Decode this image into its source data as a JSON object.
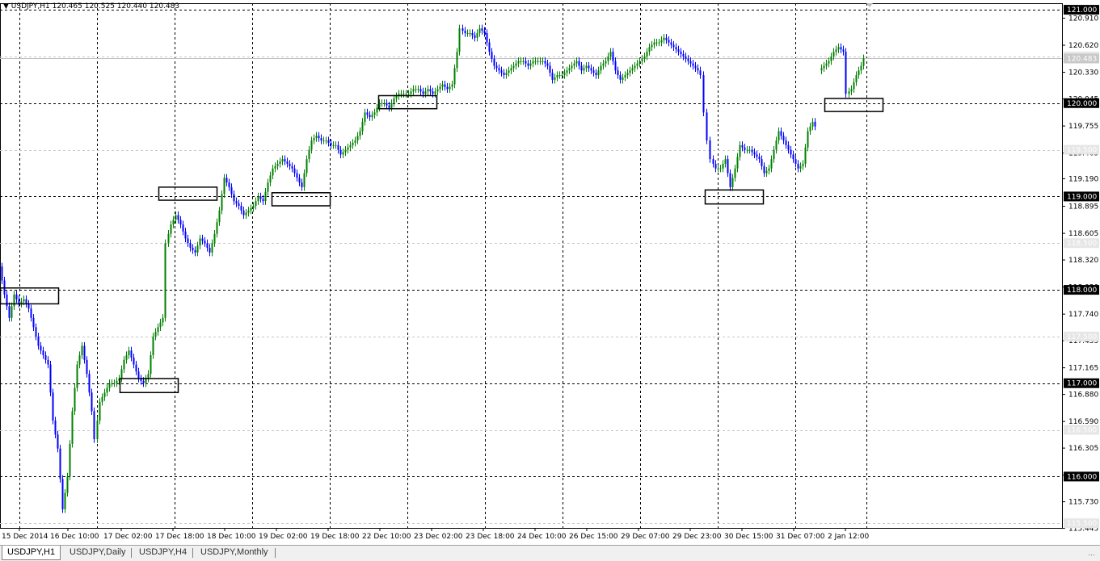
{
  "window": {
    "header_symbol": "USDJPY,H1",
    "header_ohlc": "120.465 120.525 120.440 120.483",
    "collapse_icon": "triangle-down-icon"
  },
  "tabs": [
    {
      "label": "USDJPY,H1",
      "active": true
    },
    {
      "label": "USDJPY,Daily",
      "active": false
    },
    {
      "label": "USDJPY,H4",
      "active": false
    },
    {
      "label": "USDJPY,Monthly",
      "active": false
    }
  ],
  "chart_data": {
    "type": "candlestick",
    "symbol": "USDJPY",
    "timeframe": "H1",
    "ylim": [
      115.45,
      121.07
    ],
    "grid": true,
    "colors": {
      "bull": "#008000",
      "bear": "#0000ff",
      "grid": "#000000",
      "level_line": "#000000",
      "gray_level": "#c8c8c8",
      "box": "#000000"
    },
    "price_ticks": [
      "120.910",
      "120.620",
      "120.330",
      "120.045",
      "119.755",
      "119.465",
      "119.190",
      "118.895",
      "118.605",
      "118.320",
      "118.030",
      "117.740",
      "117.455",
      "117.165",
      "116.880",
      "116.590",
      "116.305",
      "116.015",
      "115.730",
      "115.445"
    ],
    "level_labels": [
      "121.000",
      "120.000",
      "119.000",
      "118.000",
      "117.000",
      "116.000"
    ],
    "gray_level_labels": [
      "120.500",
      "119.500",
      "118.500",
      "117.500",
      "116.500",
      "115.500"
    ],
    "current_price": "120.483",
    "time_labels": [
      "15 Dec 2014",
      "16 Dec 10:00",
      "17 Dec 02:00",
      "17 Dec 18:00",
      "18 Dec 10:00",
      "19 Dec 02:00",
      "19 Dec 18:00",
      "22 Dec 10:00",
      "23 Dec 02:00",
      "23 Dec 18:00",
      "24 Dec 10:00",
      "26 Dec 15:00",
      "29 Dec 07:00",
      "29 Dec 23:00",
      "30 Dec 15:00",
      "31 Dec 07:00",
      "2 Jan 12:00"
    ],
    "price_path": [
      [
        0,
        118.25
      ],
      [
        6,
        117.95
      ],
      [
        12,
        117.7
      ],
      [
        18,
        117.95
      ],
      [
        24,
        117.85
      ],
      [
        30,
        117.9
      ],
      [
        36,
        117.8
      ],
      [
        42,
        117.6
      ],
      [
        48,
        117.4
      ],
      [
        54,
        117.3
      ],
      [
        60,
        117.2
      ],
      [
        66,
        116.6
      ],
      [
        72,
        116.3
      ],
      [
        78,
        115.65
      ],
      [
        84,
        116.0
      ],
      [
        90,
        116.7
      ],
      [
        96,
        117.2
      ],
      [
        102,
        117.4
      ],
      [
        108,
        117.1
      ],
      [
        114,
        116.7
      ],
      [
        118,
        116.4
      ],
      [
        124,
        116.8
      ],
      [
        130,
        116.9
      ],
      [
        136,
        117.0
      ],
      [
        142,
        117.0
      ],
      [
        148,
        117.05
      ],
      [
        154,
        117.25
      ],
      [
        160,
        117.35
      ],
      [
        166,
        117.2
      ],
      [
        172,
        117.05
      ],
      [
        178,
        117.0
      ],
      [
        184,
        117.1
      ],
      [
        190,
        117.5
      ],
      [
        196,
        117.6
      ],
      [
        202,
        117.7
      ],
      [
        206,
        118.5
      ],
      [
        212,
        118.7
      ],
      [
        218,
        118.8
      ],
      [
        224,
        118.7
      ],
      [
        230,
        118.55
      ],
      [
        236,
        118.45
      ],
      [
        242,
        118.4
      ],
      [
        248,
        118.55
      ],
      [
        254,
        118.5
      ],
      [
        260,
        118.4
      ],
      [
        266,
        118.6
      ],
      [
        272,
        118.85
      ],
      [
        278,
        119.2
      ],
      [
        284,
        119.1
      ],
      [
        290,
        118.95
      ],
      [
        296,
        118.9
      ],
      [
        302,
        118.8
      ],
      [
        308,
        118.85
      ],
      [
        314,
        118.9
      ],
      [
        320,
        119.0
      ],
      [
        326,
        118.95
      ],
      [
        332,
        119.15
      ],
      [
        338,
        119.3
      ],
      [
        344,
        119.35
      ],
      [
        350,
        119.4
      ],
      [
        356,
        119.35
      ],
      [
        362,
        119.3
      ],
      [
        368,
        119.2
      ],
      [
        374,
        119.1
      ],
      [
        380,
        119.4
      ],
      [
        386,
        119.6
      ],
      [
        392,
        119.65
      ],
      [
        398,
        119.6
      ],
      [
        404,
        119.6
      ],
      [
        410,
        119.55
      ],
      [
        416,
        119.55
      ],
      [
        422,
        119.45
      ],
      [
        428,
        119.5
      ],
      [
        434,
        119.55
      ],
      [
        440,
        119.6
      ],
      [
        446,
        119.7
      ],
      [
        452,
        119.9
      ],
      [
        458,
        119.85
      ],
      [
        464,
        119.9
      ],
      [
        470,
        120.0
      ],
      [
        476,
        120.0
      ],
      [
        482,
        119.95
      ],
      [
        488,
        120.05
      ],
      [
        494,
        120.1
      ],
      [
        500,
        120.1
      ],
      [
        506,
        120.1
      ],
      [
        512,
        120.15
      ],
      [
        518,
        120.15
      ],
      [
        524,
        120.1
      ],
      [
        530,
        120.15
      ],
      [
        536,
        120.1
      ],
      [
        542,
        120.15
      ],
      [
        548,
        120.2
      ],
      [
        554,
        120.15
      ],
      [
        560,
        120.2
      ],
      [
        566,
        120.55
      ],
      [
        570,
        120.8
      ],
      [
        576,
        120.75
      ],
      [
        582,
        120.75
      ],
      [
        588,
        120.7
      ],
      [
        594,
        120.8
      ],
      [
        600,
        120.75
      ],
      [
        606,
        120.55
      ],
      [
        612,
        120.4
      ],
      [
        618,
        120.35
      ],
      [
        624,
        120.3
      ],
      [
        630,
        120.35
      ],
      [
        636,
        120.4
      ],
      [
        642,
        120.45
      ],
      [
        648,
        120.45
      ],
      [
        654,
        120.4
      ],
      [
        660,
        120.45
      ],
      [
        666,
        120.45
      ],
      [
        672,
        120.45
      ],
      [
        678,
        120.4
      ],
      [
        684,
        120.25
      ],
      [
        690,
        120.3
      ],
      [
        696,
        120.3
      ],
      [
        702,
        120.35
      ],
      [
        708,
        120.4
      ],
      [
        714,
        120.45
      ],
      [
        720,
        120.35
      ],
      [
        726,
        120.4
      ],
      [
        732,
        120.35
      ],
      [
        738,
        120.3
      ],
      [
        744,
        120.4
      ],
      [
        750,
        120.45
      ],
      [
        756,
        120.55
      ],
      [
        762,
        120.35
      ],
      [
        768,
        120.25
      ],
      [
        774,
        120.3
      ],
      [
        780,
        120.35
      ],
      [
        786,
        120.4
      ],
      [
        792,
        120.45
      ],
      [
        798,
        120.5
      ],
      [
        804,
        120.6
      ],
      [
        810,
        120.65
      ],
      [
        816,
        120.65
      ],
      [
        822,
        120.7
      ],
      [
        828,
        120.65
      ],
      [
        834,
        120.6
      ],
      [
        840,
        120.55
      ],
      [
        846,
        120.5
      ],
      [
        852,
        120.45
      ],
      [
        858,
        120.4
      ],
      [
        864,
        120.35
      ],
      [
        868,
        120.3
      ],
      [
        872,
        119.9
      ],
      [
        876,
        119.6
      ],
      [
        880,
        119.4
      ],
      [
        886,
        119.3
      ],
      [
        892,
        119.3
      ],
      [
        898,
        119.4
      ],
      [
        904,
        119.1
      ],
      [
        910,
        119.3
      ],
      [
        916,
        119.55
      ],
      [
        922,
        119.5
      ],
      [
        928,
        119.5
      ],
      [
        934,
        119.45
      ],
      [
        940,
        119.4
      ],
      [
        946,
        119.25
      ],
      [
        952,
        119.3
      ],
      [
        958,
        119.5
      ],
      [
        964,
        119.7
      ],
      [
        970,
        119.6
      ],
      [
        976,
        119.5
      ],
      [
        982,
        119.4
      ],
      [
        988,
        119.3
      ],
      [
        994,
        119.35
      ],
      [
        1000,
        119.7
      ],
      [
        1006,
        119.8
      ],
      [
        1010,
        119.75
      ]
    ],
    "price_path_2": [
      [
        1014,
        120.35
      ],
      [
        1020,
        120.4
      ],
      [
        1026,
        120.45
      ],
      [
        1032,
        120.55
      ],
      [
        1038,
        120.6
      ],
      [
        1044,
        120.55
      ],
      [
        1048,
        120.1
      ],
      [
        1054,
        120.15
      ],
      [
        1060,
        120.3
      ],
      [
        1066,
        120.4
      ],
      [
        1070,
        120.48
      ]
    ],
    "highlight_boxes": [
      {
        "x0": 0,
        "x1": 72,
        "price_top": 118.02,
        "price_bottom": 117.85
      },
      {
        "x0": 148,
        "x1": 220,
        "price_top": 117.05,
        "price_bottom": 116.9
      },
      {
        "x0": 196,
        "x1": 268,
        "price_top": 119.1,
        "price_bottom": 118.96
      },
      {
        "x0": 336,
        "x1": 408,
        "price_top": 119.04,
        "price_bottom": 118.9
      },
      {
        "x0": 468,
        "x1": 540,
        "price_top": 120.08,
        "price_bottom": 119.94
      },
      {
        "x0": 872,
        "x1": 944,
        "price_top": 119.07,
        "price_bottom": 118.92
      },
      {
        "x0": 1020,
        "x1": 1092,
        "price_top": 120.05,
        "price_bottom": 119.91
      }
    ]
  }
}
